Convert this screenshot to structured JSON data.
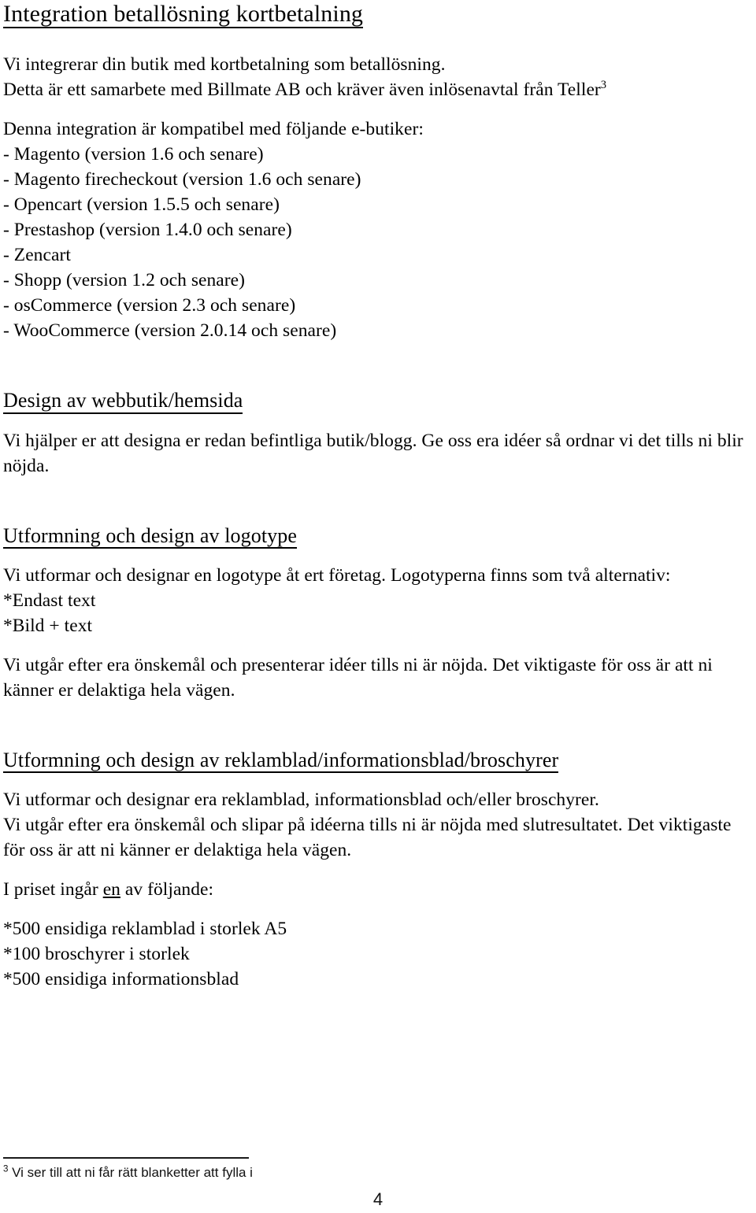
{
  "document": {
    "title": "Integration betallösning kortbetalning",
    "page_number": "4"
  },
  "sections": [
    {
      "id": "integration-kortbetalning",
      "heading": "Integration betallösning kortbetalning",
      "intro_line_1": "Vi integrerar din butik med kortbetalning som betallösning.",
      "intro_line_2_before_sup": "Detta är ett samarbete med Billmate AB och kräver även inlösenavtal från Teller",
      "intro_line_2_sup": "3",
      "compat_intro": "Denna integration är kompatibel med följande e-butiker:",
      "shops": [
        "- Magento (version 1.6 och senare)",
        "- Magento firecheckout (version 1.6 och senare)",
        "- Opencart (version 1.5.5 och senare)",
        "- Prestashop (version 1.4.0 och senare)",
        "- Zencart",
        "- Shopp (version 1.2 och senare)",
        "- osCommerce (version 2.3 och senare)",
        "- WooCommerce (version 2.0.14 och senare)"
      ]
    },
    {
      "id": "design-webbutik",
      "heading": "Design av webbutik/hemsida",
      "body": "Vi hjälper er att designa er redan befintliga butik/blogg. Ge oss era idéer så ordnar vi det tills ni blir nöjda."
    },
    {
      "id": "design-logotype",
      "heading": "Utformning och design av logotype",
      "body_1": "Vi utformar och designar en logotype åt ert företag. Logotyperna finns som två alternativ:",
      "options": [
        "*Endast text",
        "*Bild + text"
      ],
      "body_2": "Vi utgår efter era önskemål och presenterar idéer tills ni är nöjda. Det viktigaste för oss är att ni känner er delaktiga hela vägen."
    },
    {
      "id": "design-reklamblad",
      "heading": "Utformning och design av reklamblad/informationsblad/broschyrer",
      "body_1": "Vi utformar och designar era reklamblad, informationsblad och/eller broschyrer.",
      "body_2": "Vi utgår efter era önskemål och slipar på idéerna tills ni är nöjda med slutresultatet. Det viktigaste för oss är att ni känner er delaktiga hela vägen.",
      "price_intro_before": "I priset ingår ",
      "price_intro_underlined": "en",
      "price_intro_after": " av följande:",
      "price_items": [
        "*500 ensidiga reklamblad i storlek A5",
        "*100 broschyrer i storlek",
        "*500 ensidiga informationsblad"
      ]
    }
  ],
  "footnote": {
    "marker": "3",
    "text": " Vi ser till att ni får rätt blanketter att fylla i"
  }
}
